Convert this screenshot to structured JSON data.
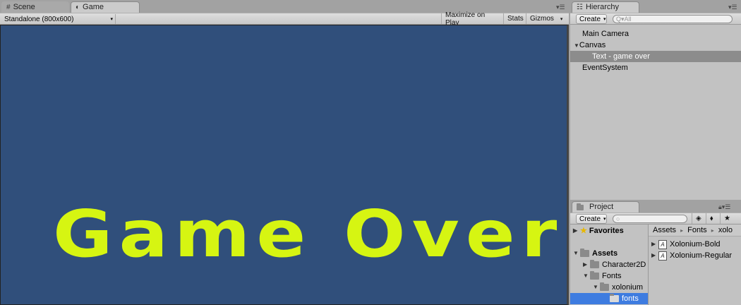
{
  "game_panel": {
    "tabs": [
      {
        "label": "Scene",
        "icon": "grid-icon"
      },
      {
        "label": "Game",
        "icon": "pacman-icon"
      }
    ],
    "resolution": "Standalone (800x600)",
    "maximize_on_play": "Maximize on Play",
    "stats": "Stats",
    "gizmos": "Gizmos",
    "game_text": "Game Over",
    "game_text_color": "#d6f512",
    "background_color": "#304f7b"
  },
  "hierarchy": {
    "tab_label": "Hierarchy",
    "create_label": "Create",
    "search_placeholder": "Q▾All",
    "items": [
      {
        "label": "Main Camera"
      },
      {
        "label": "Canvas"
      },
      {
        "label": "Text - game over"
      },
      {
        "label": "EventSystem"
      }
    ]
  },
  "project": {
    "tab_label": "Project",
    "create_label": "Create",
    "tree": [
      {
        "label": "Favorites"
      },
      {
        "label": "Assets"
      },
      {
        "label": "Character2D"
      },
      {
        "label": "Fonts"
      },
      {
        "label": "xolonium"
      },
      {
        "label": "fonts"
      }
    ],
    "breadcrumb": [
      "Assets",
      "Fonts",
      "xolo"
    ],
    "files": [
      {
        "label": "Xolonium-Bold"
      },
      {
        "label": "Xolonium-Regular"
      }
    ]
  }
}
